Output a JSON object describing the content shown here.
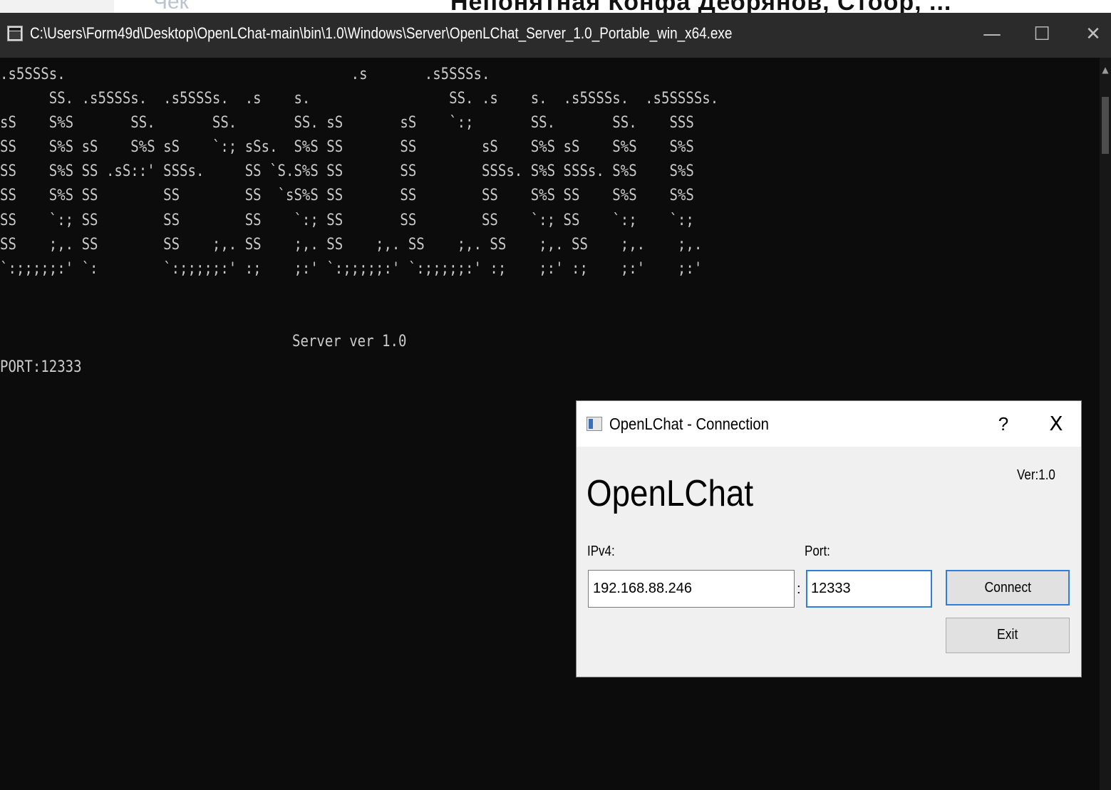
{
  "background_window": {
    "title_fragment": "Непонятная Конфа Дебрянов, Стоор, ...",
    "left_fragment": "Чек"
  },
  "console": {
    "title": "C:\\Users\\Form49d\\Desktop\\OpenLChat-main\\bin\\1.0\\Windows\\Server\\OpenLChat_Server_1.0_Portable_win_x64.exe",
    "controls": {
      "minimize": "—",
      "maximize": "☐",
      "close": "✕"
    },
    "ascii_banner": ".s5SSSs.                                   .s       .s5SSSs.\n      SS. .s5SSSs.  .s5SSSs.  .s    s.                 SS. .s    s.  .s5SSSs.  .s5SSSSs.\nsS    S%S       SS.       SS.       SS. sS       sS    `:;       SS.       SS.    SSS\nSS    S%S sS    S%S sS    `:; sSs.  S%S SS       SS        sS    S%S sS    S%S    S%S\nSS    S%S SS .sS::' SSSs.     SS `S.S%S SS       SS        SSSs. S%S SSSs. S%S    S%S\nSS    S%S SS        SS        SS  `sS%S SS       SS        SS    S%S SS    S%S    S%S\nSS    `:; SS        SS        SS    `:; SS       SS        SS    `:; SS    `:;    `:;\nSS    ;,. SS        SS    ;,. SS    ;,. SS    ;,. SS    ;,. SS    ;,. SS    ;,.    ;,.\n`:;;;;;:' `:        `:;;;;;:' :;    ;:' `:;;;;;:' `:;;;;;:' :;    ;:' :;    ;:'    ;:'",
    "server_version": "Server ver 1.0",
    "port_line": "PORT:12333"
  },
  "dialog": {
    "title": "OpenLChat - Connection",
    "help": "?",
    "close": "X",
    "brand": "OpenLChat",
    "version": "Ver:1.0",
    "ip_label": "IPv4:",
    "ip_value": "192.168.88.246",
    "port_label": "Port:",
    "port_value": "12333",
    "separator": ":",
    "connect_label": "Connect",
    "exit_label": "Exit"
  },
  "colors": {
    "console_bg": "#0c0c0c",
    "console_text": "#cccccc",
    "titlebar_bg": "#2b2b2b",
    "dialog_bg": "#f0f0f0",
    "focus_accent": "#2f7ed8"
  }
}
